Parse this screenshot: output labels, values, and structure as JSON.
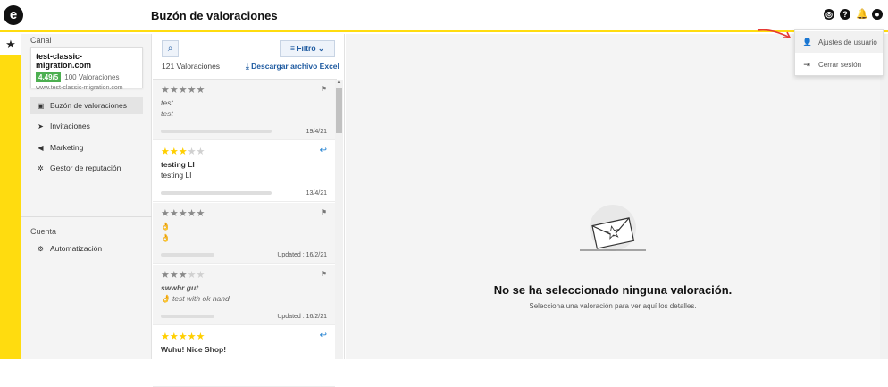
{
  "app": {
    "logo": "e",
    "page_title": "Buzón de valoraciones"
  },
  "topbar_icons": [
    "help-circle-icon",
    "question-icon",
    "bell-icon",
    "user-icon"
  ],
  "dropdown": {
    "items": [
      {
        "label": "Ajustes de usuario",
        "icon": "user-icon"
      },
      {
        "label": "Cerrar sesión",
        "icon": "logout-icon"
      }
    ]
  },
  "rail": {
    "star": "★"
  },
  "sidebar": {
    "channel_label": "Canal",
    "channel": {
      "name": "test-classic-migration.com",
      "score": "4.49/5",
      "reviews": "100 Valoraciones",
      "url": "www.test-classic-migration.com"
    },
    "nav": [
      {
        "label": "Buzón de valoraciones",
        "icon": "inbox-icon",
        "active": true
      },
      {
        "label": "Invitaciones",
        "icon": "send-icon",
        "active": false
      },
      {
        "label": "Marketing",
        "icon": "megaphone-icon",
        "active": false
      },
      {
        "label": "Gestor de reputación",
        "icon": "sparkle-icon",
        "active": false
      }
    ],
    "account_label": "Cuenta",
    "account_nav": [
      {
        "label": "Automatización",
        "icon": "robot-icon"
      }
    ]
  },
  "list": {
    "filter_label": "Filtro",
    "count": "121 Valoraciones",
    "download": "Descargar archivo Excel",
    "reviews": [
      {
        "stars": 0,
        "title": "test",
        "body": "test",
        "date": "19/4/21",
        "italic": true,
        "flag": true,
        "reply": false
      },
      {
        "stars": 3,
        "title": "testing LI",
        "body": "testing LI",
        "date": "13/4/21",
        "italic": false,
        "flag": false,
        "reply": true
      },
      {
        "stars": 0,
        "title": "👌",
        "body": "👌",
        "date": "Updated : 16/2/21",
        "italic": false,
        "flag": true,
        "reply": false
      },
      {
        "stars": 3,
        "title": "swwhr gut",
        "body": "👌 test with ok hand",
        "date": "Updated : 16/2/21",
        "italic": true,
        "flag": true,
        "reply": false
      },
      {
        "stars": 5,
        "title": "Wuhu! Nice Shop!",
        "body": "",
        "date": "",
        "italic": false,
        "flag": false,
        "reply": true
      }
    ]
  },
  "detail": {
    "empty_title": "No se ha seleccionado ninguna valoración.",
    "empty_subtitle": "Selecciona una valoración para ver aquí los detalles."
  }
}
